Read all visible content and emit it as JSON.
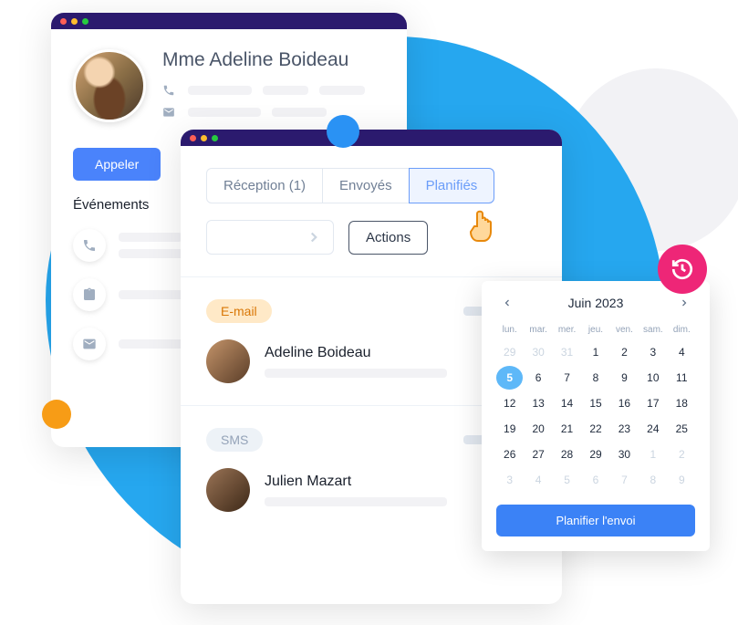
{
  "profile": {
    "name": "Mme Adeline Boideau",
    "call_button": "Appeler",
    "events_label": "Événements"
  },
  "messages": {
    "tabs": {
      "reception": "Réception (1)",
      "sent": "Envoyés",
      "planned": "Planifiés"
    },
    "actions_button": "Actions",
    "items": [
      {
        "type": "E-mail",
        "name": "Adeline Boideau"
      },
      {
        "type": "SMS",
        "name": "Julien Mazart"
      }
    ]
  },
  "calendar": {
    "title": "Juin 2023",
    "dow": [
      "lun.",
      "mar.",
      "mer.",
      "jeu.",
      "ven.",
      "sam.",
      "dim."
    ],
    "days": [
      {
        "n": 29,
        "muted": true
      },
      {
        "n": 30,
        "muted": true
      },
      {
        "n": 31,
        "muted": true
      },
      {
        "n": 1
      },
      {
        "n": 2
      },
      {
        "n": 3
      },
      {
        "n": 4
      },
      {
        "n": 5,
        "selected": true
      },
      {
        "n": 6
      },
      {
        "n": 7
      },
      {
        "n": 8
      },
      {
        "n": 9
      },
      {
        "n": 10
      },
      {
        "n": 11
      },
      {
        "n": 12
      },
      {
        "n": 13
      },
      {
        "n": 14
      },
      {
        "n": 15
      },
      {
        "n": 16
      },
      {
        "n": 17
      },
      {
        "n": 18
      },
      {
        "n": 19
      },
      {
        "n": 20
      },
      {
        "n": 21
      },
      {
        "n": 22
      },
      {
        "n": 23
      },
      {
        "n": 24
      },
      {
        "n": 25
      },
      {
        "n": 26
      },
      {
        "n": 27
      },
      {
        "n": 28
      },
      {
        "n": 29
      },
      {
        "n": 30
      },
      {
        "n": 1,
        "muted": true
      },
      {
        "n": 2,
        "muted": true
      },
      {
        "n": 3,
        "muted": true
      },
      {
        "n": 4,
        "muted": true
      },
      {
        "n": 5,
        "muted": true
      },
      {
        "n": 6,
        "muted": true
      },
      {
        "n": 7,
        "muted": true
      },
      {
        "n": 8,
        "muted": true
      },
      {
        "n": 9,
        "muted": true
      }
    ],
    "schedule_button": "Planifier l'envoi"
  }
}
